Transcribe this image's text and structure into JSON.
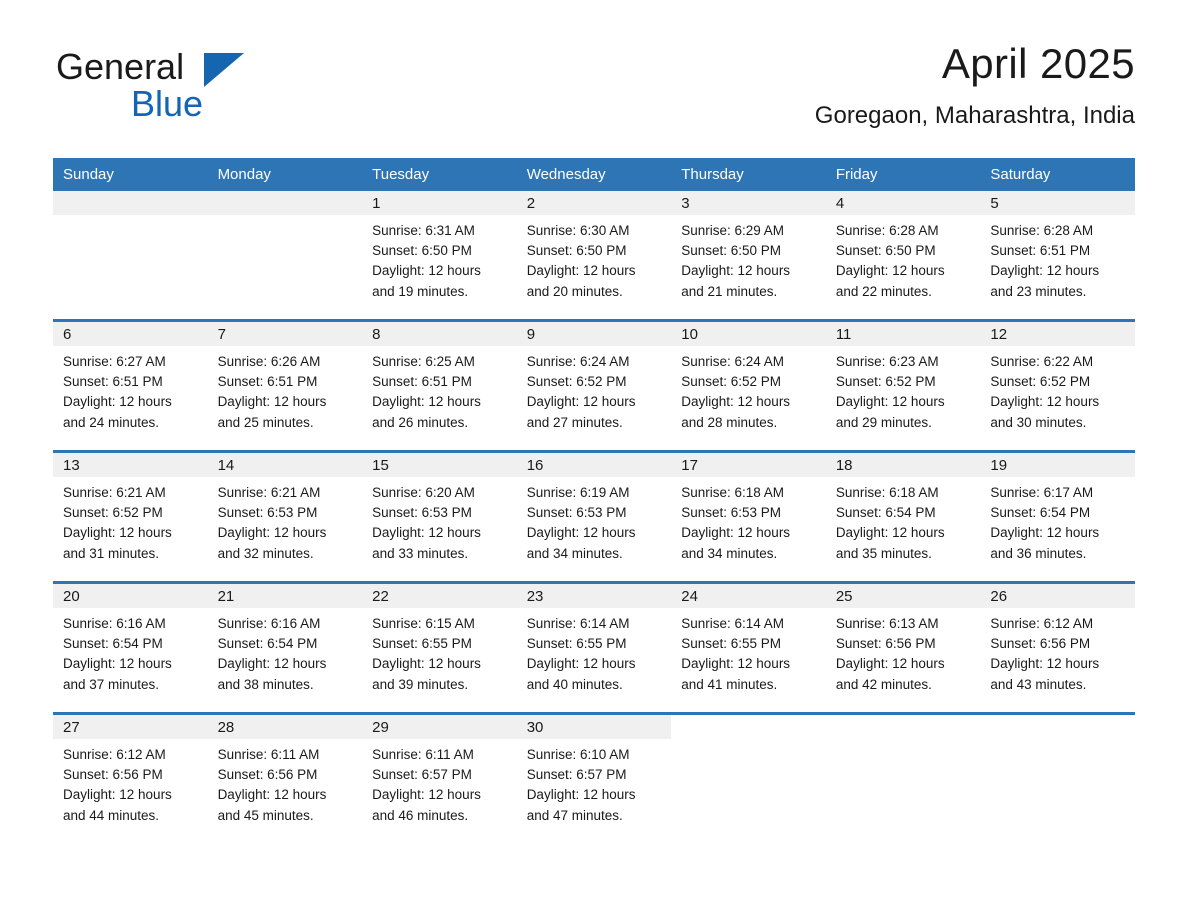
{
  "logo": {
    "word1": "General",
    "word2": "Blue",
    "triangle_color": "#1565b0",
    "word2_color": "#1266b5"
  },
  "header": {
    "title": "April 2025",
    "subtitle": "Goregaon, Maharashtra, India"
  },
  "colors": {
    "header_blue": "#2e75b6",
    "date_band_gray": "#f0f0f0",
    "text": "#1a1a1a"
  },
  "weekday_headers": [
    "Sunday",
    "Monday",
    "Tuesday",
    "Wednesday",
    "Thursday",
    "Friday",
    "Saturday"
  ],
  "weeks": [
    {
      "days": [
        {
          "date": "",
          "sunrise": "",
          "sunset": "",
          "daylight_line1": "",
          "daylight_line2": ""
        },
        {
          "date": "",
          "sunrise": "",
          "sunset": "",
          "daylight_line1": "",
          "daylight_line2": ""
        },
        {
          "date": "1",
          "sunrise": "Sunrise: 6:31 AM",
          "sunset": "Sunset: 6:50 PM",
          "daylight_line1": "Daylight: 12 hours",
          "daylight_line2": "and 19 minutes."
        },
        {
          "date": "2",
          "sunrise": "Sunrise: 6:30 AM",
          "sunset": "Sunset: 6:50 PM",
          "daylight_line1": "Daylight: 12 hours",
          "daylight_line2": "and 20 minutes."
        },
        {
          "date": "3",
          "sunrise": "Sunrise: 6:29 AM",
          "sunset": "Sunset: 6:50 PM",
          "daylight_line1": "Daylight: 12 hours",
          "daylight_line2": "and 21 minutes."
        },
        {
          "date": "4",
          "sunrise": "Sunrise: 6:28 AM",
          "sunset": "Sunset: 6:50 PM",
          "daylight_line1": "Daylight: 12 hours",
          "daylight_line2": "and 22 minutes."
        },
        {
          "date": "5",
          "sunrise": "Sunrise: 6:28 AM",
          "sunset": "Sunset: 6:51 PM",
          "daylight_line1": "Daylight: 12 hours",
          "daylight_line2": "and 23 minutes."
        }
      ]
    },
    {
      "days": [
        {
          "date": "6",
          "sunrise": "Sunrise: 6:27 AM",
          "sunset": "Sunset: 6:51 PM",
          "daylight_line1": "Daylight: 12 hours",
          "daylight_line2": "and 24 minutes."
        },
        {
          "date": "7",
          "sunrise": "Sunrise: 6:26 AM",
          "sunset": "Sunset: 6:51 PM",
          "daylight_line1": "Daylight: 12 hours",
          "daylight_line2": "and 25 minutes."
        },
        {
          "date": "8",
          "sunrise": "Sunrise: 6:25 AM",
          "sunset": "Sunset: 6:51 PM",
          "daylight_line1": "Daylight: 12 hours",
          "daylight_line2": "and 26 minutes."
        },
        {
          "date": "9",
          "sunrise": "Sunrise: 6:24 AM",
          "sunset": "Sunset: 6:52 PM",
          "daylight_line1": "Daylight: 12 hours",
          "daylight_line2": "and 27 minutes."
        },
        {
          "date": "10",
          "sunrise": "Sunrise: 6:24 AM",
          "sunset": "Sunset: 6:52 PM",
          "daylight_line1": "Daylight: 12 hours",
          "daylight_line2": "and 28 minutes."
        },
        {
          "date": "11",
          "sunrise": "Sunrise: 6:23 AM",
          "sunset": "Sunset: 6:52 PM",
          "daylight_line1": "Daylight: 12 hours",
          "daylight_line2": "and 29 minutes."
        },
        {
          "date": "12",
          "sunrise": "Sunrise: 6:22 AM",
          "sunset": "Sunset: 6:52 PM",
          "daylight_line1": "Daylight: 12 hours",
          "daylight_line2": "and 30 minutes."
        }
      ]
    },
    {
      "days": [
        {
          "date": "13",
          "sunrise": "Sunrise: 6:21 AM",
          "sunset": "Sunset: 6:52 PM",
          "daylight_line1": "Daylight: 12 hours",
          "daylight_line2": "and 31 minutes."
        },
        {
          "date": "14",
          "sunrise": "Sunrise: 6:21 AM",
          "sunset": "Sunset: 6:53 PM",
          "daylight_line1": "Daylight: 12 hours",
          "daylight_line2": "and 32 minutes."
        },
        {
          "date": "15",
          "sunrise": "Sunrise: 6:20 AM",
          "sunset": "Sunset: 6:53 PM",
          "daylight_line1": "Daylight: 12 hours",
          "daylight_line2": "and 33 minutes."
        },
        {
          "date": "16",
          "sunrise": "Sunrise: 6:19 AM",
          "sunset": "Sunset: 6:53 PM",
          "daylight_line1": "Daylight: 12 hours",
          "daylight_line2": "and 34 minutes."
        },
        {
          "date": "17",
          "sunrise": "Sunrise: 6:18 AM",
          "sunset": "Sunset: 6:53 PM",
          "daylight_line1": "Daylight: 12 hours",
          "daylight_line2": "and 34 minutes."
        },
        {
          "date": "18",
          "sunrise": "Sunrise: 6:18 AM",
          "sunset": "Sunset: 6:54 PM",
          "daylight_line1": "Daylight: 12 hours",
          "daylight_line2": "and 35 minutes."
        },
        {
          "date": "19",
          "sunrise": "Sunrise: 6:17 AM",
          "sunset": "Sunset: 6:54 PM",
          "daylight_line1": "Daylight: 12 hours",
          "daylight_line2": "and 36 minutes."
        }
      ]
    },
    {
      "days": [
        {
          "date": "20",
          "sunrise": "Sunrise: 6:16 AM",
          "sunset": "Sunset: 6:54 PM",
          "daylight_line1": "Daylight: 12 hours",
          "daylight_line2": "and 37 minutes."
        },
        {
          "date": "21",
          "sunrise": "Sunrise: 6:16 AM",
          "sunset": "Sunset: 6:54 PM",
          "daylight_line1": "Daylight: 12 hours",
          "daylight_line2": "and 38 minutes."
        },
        {
          "date": "22",
          "sunrise": "Sunrise: 6:15 AM",
          "sunset": "Sunset: 6:55 PM",
          "daylight_line1": "Daylight: 12 hours",
          "daylight_line2": "and 39 minutes."
        },
        {
          "date": "23",
          "sunrise": "Sunrise: 6:14 AM",
          "sunset": "Sunset: 6:55 PM",
          "daylight_line1": "Daylight: 12 hours",
          "daylight_line2": "and 40 minutes."
        },
        {
          "date": "24",
          "sunrise": "Sunrise: 6:14 AM",
          "sunset": "Sunset: 6:55 PM",
          "daylight_line1": "Daylight: 12 hours",
          "daylight_line2": "and 41 minutes."
        },
        {
          "date": "25",
          "sunrise": "Sunrise: 6:13 AM",
          "sunset": "Sunset: 6:56 PM",
          "daylight_line1": "Daylight: 12 hours",
          "daylight_line2": "and 42 minutes."
        },
        {
          "date": "26",
          "sunrise": "Sunrise: 6:12 AM",
          "sunset": "Sunset: 6:56 PM",
          "daylight_line1": "Daylight: 12 hours",
          "daylight_line2": "and 43 minutes."
        }
      ]
    },
    {
      "days": [
        {
          "date": "27",
          "sunrise": "Sunrise: 6:12 AM",
          "sunset": "Sunset: 6:56 PM",
          "daylight_line1": "Daylight: 12 hours",
          "daylight_line2": "and 44 minutes."
        },
        {
          "date": "28",
          "sunrise": "Sunrise: 6:11 AM",
          "sunset": "Sunset: 6:56 PM",
          "daylight_line1": "Daylight: 12 hours",
          "daylight_line2": "and 45 minutes."
        },
        {
          "date": "29",
          "sunrise": "Sunrise: 6:11 AM",
          "sunset": "Sunset: 6:57 PM",
          "daylight_line1": "Daylight: 12 hours",
          "daylight_line2": "and 46 minutes."
        },
        {
          "date": "30",
          "sunrise": "Sunrise: 6:10 AM",
          "sunset": "Sunset: 6:57 PM",
          "daylight_line1": "Daylight: 12 hours",
          "daylight_line2": "and 47 minutes."
        },
        {
          "date": "",
          "sunrise": "",
          "sunset": "",
          "daylight_line1": "",
          "daylight_line2": ""
        },
        {
          "date": "",
          "sunrise": "",
          "sunset": "",
          "daylight_line1": "",
          "daylight_line2": ""
        },
        {
          "date": "",
          "sunrise": "",
          "sunset": "",
          "daylight_line1": "",
          "daylight_line2": ""
        }
      ]
    }
  ]
}
